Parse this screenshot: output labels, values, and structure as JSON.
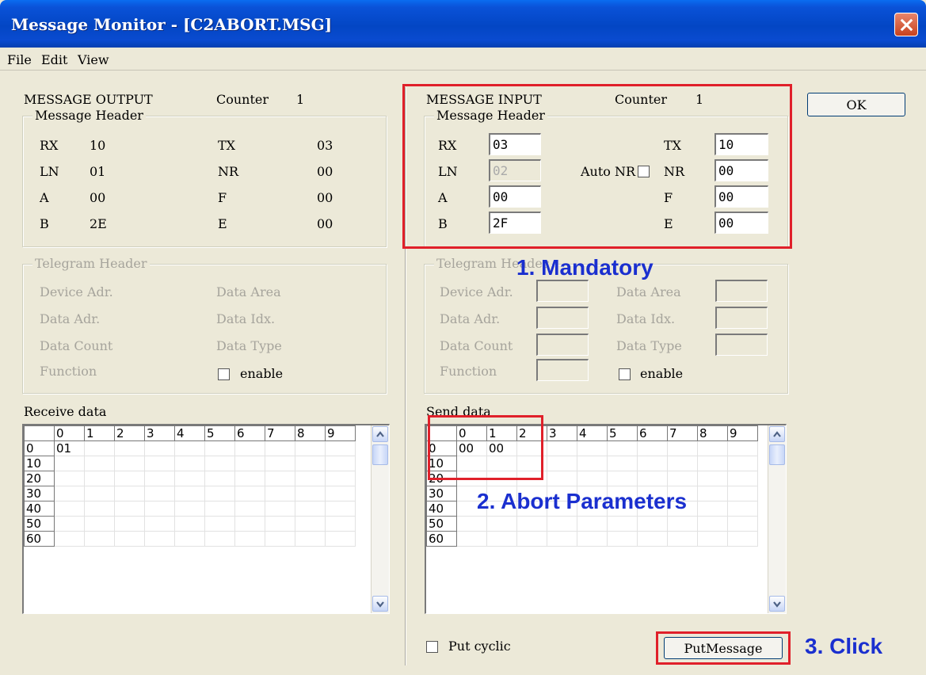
{
  "window": {
    "title": "Message Monitor - [C2ABORT.MSG]"
  },
  "menu": [
    "File",
    "Edit",
    "View"
  ],
  "output": {
    "title": "MESSAGE OUTPUT",
    "counter_label": "Counter",
    "counter_value": "1",
    "header_group": "Message Header",
    "rows": [
      {
        "l1": "RX",
        "v1": "10",
        "l2": "TX",
        "v2": "03"
      },
      {
        "l1": "LN",
        "v1": "01",
        "l2": "NR",
        "v2": "00"
      },
      {
        "l1": "A",
        "v1": "00",
        "l2": "F",
        "v2": "00"
      },
      {
        "l1": "B",
        "v1": "2E",
        "l2": "E",
        "v2": "00"
      }
    ],
    "telegram_group": "Telegram Header",
    "telegram": [
      "Device Adr.",
      "Data Area",
      "Data Adr.",
      "Data Idx.",
      "Data Count",
      "Data Type",
      "Function"
    ],
    "enable_label": "enable",
    "grid_label": "Receive data",
    "grid_cols": [
      "0",
      "1",
      "2",
      "3",
      "4",
      "5",
      "6",
      "7",
      "8",
      "9"
    ],
    "grid_rows": [
      "0",
      "10",
      "20",
      "30",
      "40",
      "50",
      "60"
    ],
    "grid_values": [
      "01"
    ]
  },
  "input": {
    "title": "MESSAGE INPUT",
    "counter_label": "Counter",
    "counter_value": "1",
    "header_group": "Message Header",
    "rx_label": "RX",
    "rx": "03",
    "ln_label": "LN",
    "ln": "02",
    "a_label": "A",
    "a": "00",
    "b_label": "B",
    "b": "2F",
    "tx_label": "TX",
    "tx": "10",
    "nr_label": "NR",
    "nr": "00",
    "f_label": "F",
    "f": "00",
    "e_label": "E",
    "e": "00",
    "auto_nr_label": "Auto NR",
    "telegram_group": "Telegram Header",
    "telegram": [
      "Device Adr.",
      "Data Area",
      "Data Adr.",
      "Data Idx.",
      "Data Count",
      "Data Type",
      "Function"
    ],
    "enable_label": "enable",
    "grid_label": "Send data",
    "grid_cols": [
      "0",
      "1",
      "2",
      "3",
      "4",
      "5",
      "6",
      "7",
      "8",
      "9"
    ],
    "grid_rows": [
      "0",
      "10",
      "20",
      "30",
      "40",
      "50",
      "60"
    ],
    "grid_values": [
      "00",
      "00"
    ],
    "put_cyclic_label": "Put cyclic",
    "put_message_label": "PutMessage"
  },
  "ok_label": "OK",
  "annotations": {
    "mandatory": "1. Mandatory",
    "abort": "2. Abort Parameters",
    "click": "3. Click",
    "color": "#1a2fcf",
    "box_color": "#e0202a"
  }
}
